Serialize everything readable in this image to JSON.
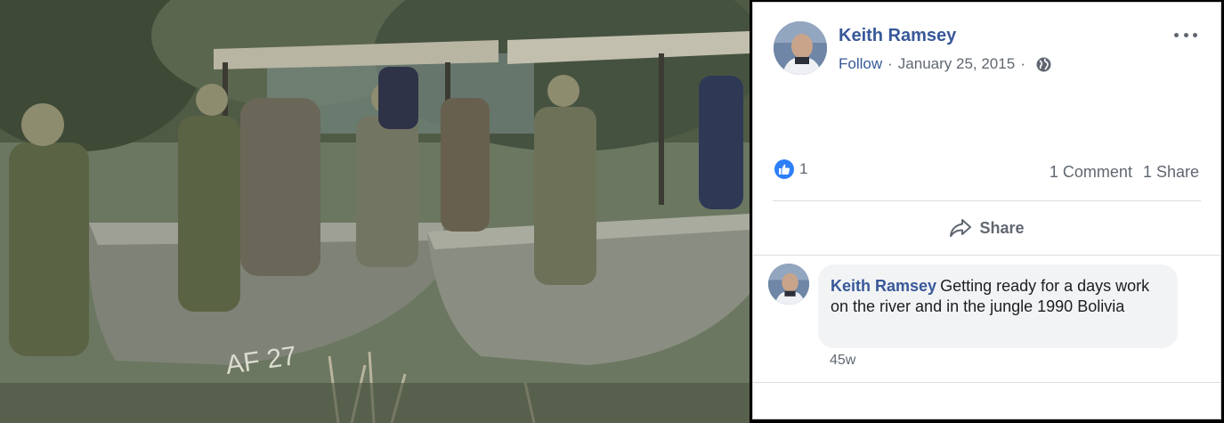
{
  "post": {
    "author": "Keith Ramsey",
    "follow_label": "Follow",
    "separator": "·",
    "date": "January 25, 2015",
    "privacy_icon": "globe-icon",
    "more_icon": "more-options-icon"
  },
  "reactions": {
    "like_icon": "like-icon",
    "like_count": "1",
    "comments_label": "1 Comment",
    "shares_label": "1 Share"
  },
  "actions": {
    "share_label": "Share",
    "share_icon": "share-arrow-icon"
  },
  "comment": {
    "author": "Keith Ramsey",
    "text": "Getting ready for a days work on the river and in the jungle 1990 Bolivia",
    "time": "45w"
  },
  "colors": {
    "link_blue": "#385898",
    "secondary_text": "#606770",
    "like_blue": "#2d7ff9",
    "bubble_bg": "#f2f3f5"
  }
}
